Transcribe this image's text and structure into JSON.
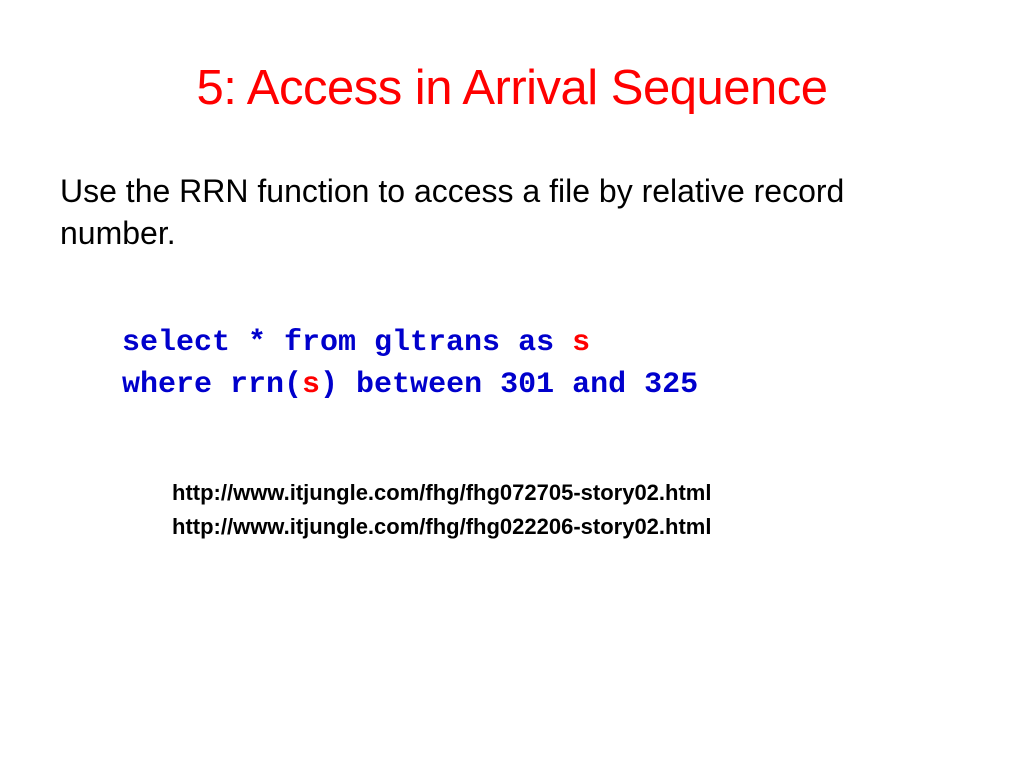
{
  "title": "5: Access in Arrival Sequence",
  "body": "Use the RRN function to access a file by relative record number.",
  "code": {
    "line1_a": "select * from gltrans as ",
    "line1_b": "s",
    "line2_a": "where rrn(",
    "line2_b": "s",
    "line2_c": ") between 301 and 325"
  },
  "links": [
    "http://www.itjungle.com/fhg/fhg072705-story02.html",
    "http://www.itjungle.com/fhg/fhg022206-story02.html"
  ]
}
